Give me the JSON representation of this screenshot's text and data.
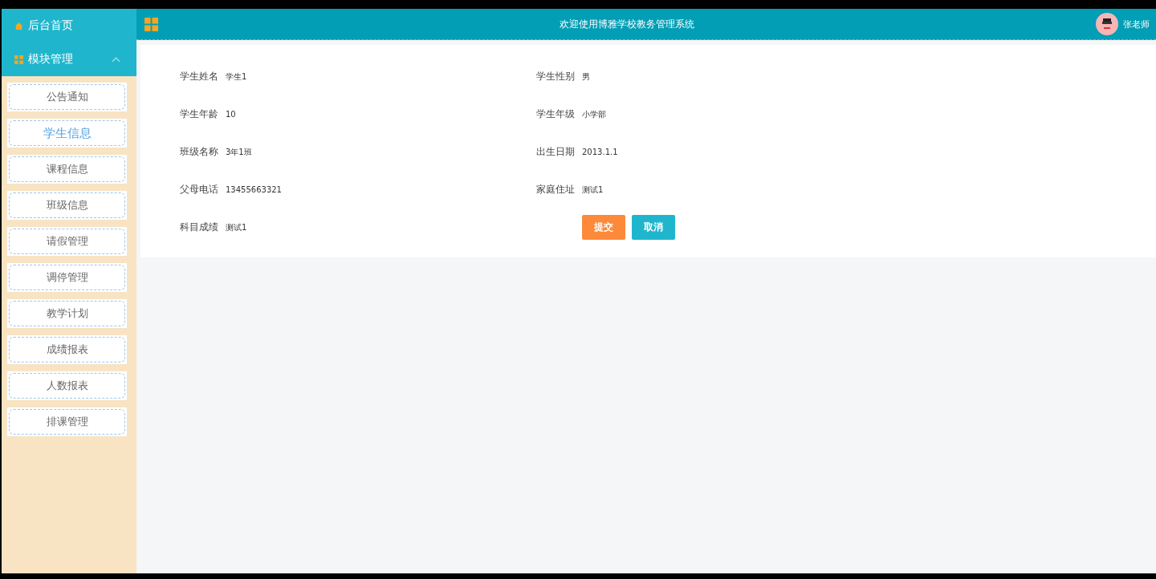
{
  "sidebar": {
    "home": {
      "label": "后台首页"
    },
    "module": {
      "label": "模块管理",
      "expanded": true
    },
    "items": [
      {
        "label": "公告通知",
        "selected": false
      },
      {
        "label": "学生信息",
        "selected": true
      },
      {
        "label": "课程信息",
        "selected": false
      },
      {
        "label": "班级信息",
        "selected": false
      },
      {
        "label": "请假管理",
        "selected": false
      },
      {
        "label": "调停管理",
        "selected": false
      },
      {
        "label": "教学计划",
        "selected": false
      },
      {
        "label": "成绩报表",
        "selected": false
      },
      {
        "label": "人数报表",
        "selected": false
      },
      {
        "label": "排课管理",
        "selected": false
      }
    ]
  },
  "header": {
    "title": "欢迎使用博雅学校教务管理系统",
    "user": "张老师"
  },
  "form": {
    "fields": [
      {
        "label": "学生姓名",
        "value": "学生1"
      },
      {
        "label": "学生性别",
        "value": "男"
      },
      {
        "label": "学生年龄",
        "value": "10"
      },
      {
        "label": "学生年级",
        "value": "小学部"
      },
      {
        "label": "班级名称",
        "value": "3年1班"
      },
      {
        "label": "出生日期",
        "value": "2013.1.1"
      },
      {
        "label": "父母电话",
        "value": "13455663321"
      },
      {
        "label": "家庭住址",
        "value": "测试1"
      },
      {
        "label": "科目成绩",
        "value": "测试1"
      }
    ],
    "buttons": [
      {
        "label": "提交",
        "kind": "primary"
      },
      {
        "label": "取消",
        "kind": "secondary"
      }
    ]
  }
}
